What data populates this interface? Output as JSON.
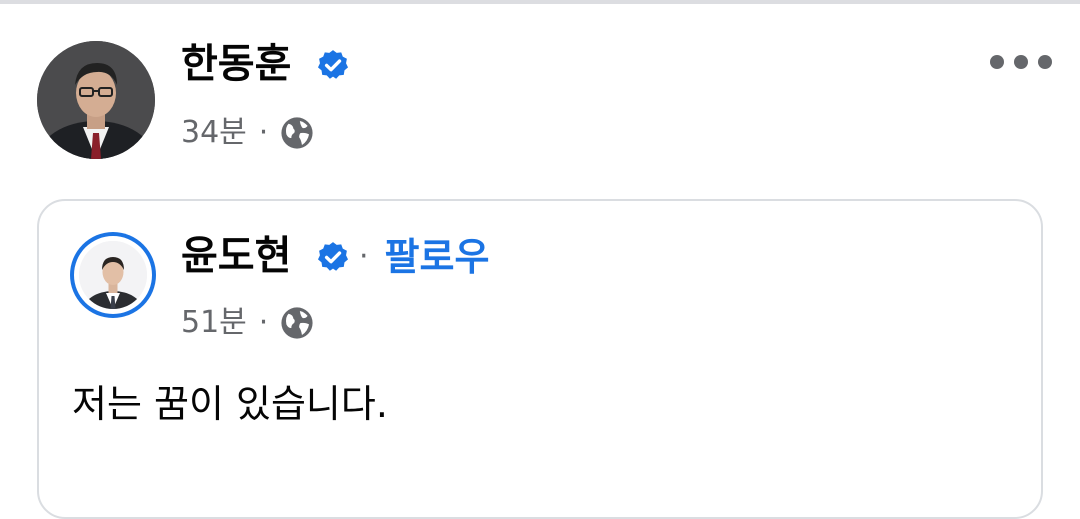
{
  "post": {
    "author_name": "한동훈",
    "verified_icon": "verified-badge-icon",
    "time": "34분",
    "separator": "·",
    "privacy_icon": "globe-icon",
    "more_icon": "more-options-icon"
  },
  "shared_post": {
    "author_name": "윤도현",
    "verified_icon": "verified-badge-icon",
    "separator": "·",
    "follow_label": "팔로우",
    "time": "51분",
    "privacy_icon": "globe-icon",
    "text": "저는 꿈이 있습니다."
  },
  "colors": {
    "accent": "#1b74e4",
    "secondary_text": "#65676b",
    "primary_text": "#050505",
    "border": "#dadde1"
  }
}
